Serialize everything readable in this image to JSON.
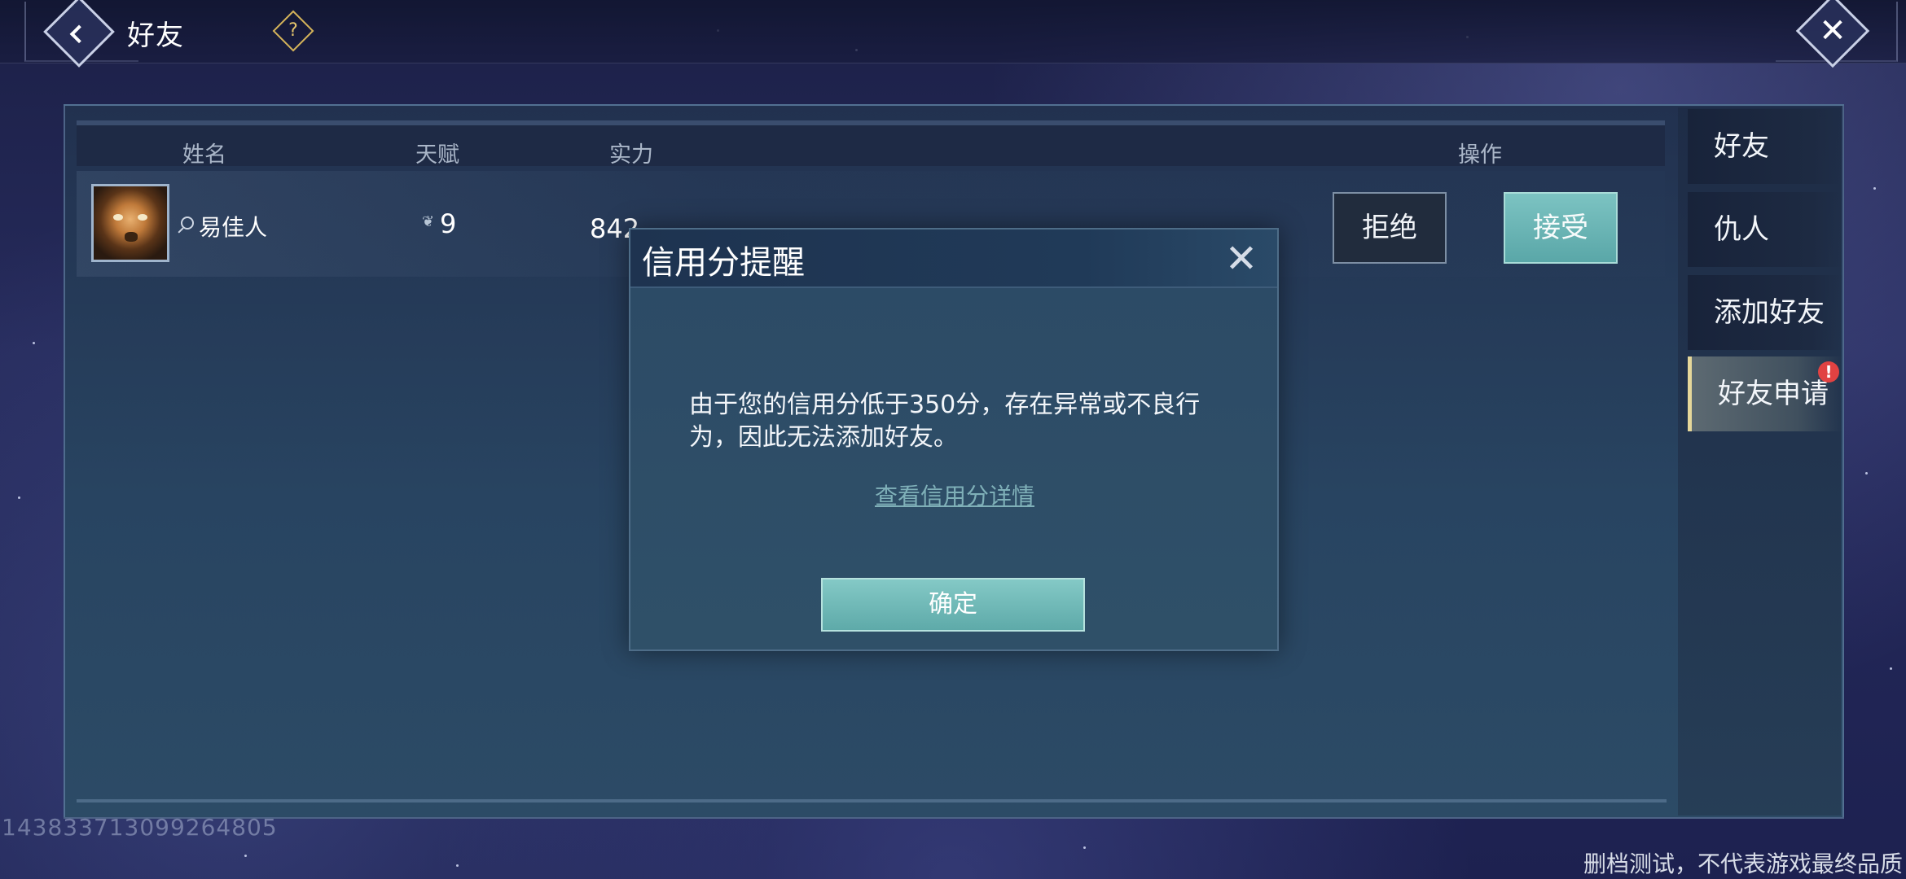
{
  "header": {
    "title": "好友",
    "help_icon": "question-icon",
    "help_glyph": "?",
    "close_glyph": "✕"
  },
  "table": {
    "columns": [
      "姓名",
      "天赋",
      "实力",
      "操作"
    ],
    "rows": [
      {
        "name": "易佳人",
        "talent": "9",
        "power": "842",
        "reject_label": "拒绝",
        "accept_label": "接受"
      }
    ]
  },
  "side_tabs": [
    {
      "label": "好友",
      "active": false
    },
    {
      "label": "仇人",
      "active": false
    },
    {
      "label": "添加好友",
      "active": false
    },
    {
      "label": "好友申请",
      "active": true
    }
  ],
  "side_badge": "!",
  "dialog": {
    "title": "信用分提醒",
    "close_glyph": "✕",
    "message": "由于您的信用分低于350分，存在异常或不良行为，因此无法添加好友。",
    "link_text": "查看信用分详情",
    "confirm_label": "确定"
  },
  "footer": {
    "uid": "1438337130992648​05",
    "watermark": "删档测试，不代表游戏最终品质"
  },
  "colors": {
    "accent_teal": "#6cb8b7",
    "badge_red": "#e14242",
    "active_tab_border": "#e6d79a"
  }
}
